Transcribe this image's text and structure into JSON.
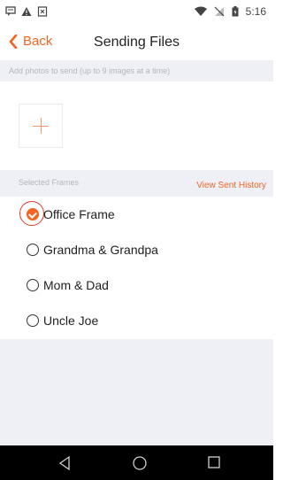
{
  "status_bar": {
    "time": "5:16",
    "left_icons": [
      "message-icon",
      "warning-icon",
      "download-box-icon"
    ],
    "right_icons": [
      "wifi-icon",
      "no-sim-icon",
      "battery-icon"
    ]
  },
  "nav": {
    "back_label": "Back",
    "title": "Sending Files"
  },
  "photos": {
    "hint": "Add photos to send (up to 9 images at a time)",
    "add_icon": "plus-icon"
  },
  "frames_section": {
    "label": "Selected Frames",
    "history_link": "View Sent History"
  },
  "frames": [
    {
      "name": "Office Frame",
      "selected": true
    },
    {
      "name": "Grandma & Grandpa",
      "selected": false
    },
    {
      "name": "Mom & Dad",
      "selected": false
    },
    {
      "name": "Uncle Joe",
      "selected": false
    }
  ],
  "android_nav": {
    "icons": [
      "back-triangle-icon",
      "home-circle-icon",
      "recents-square-icon"
    ]
  },
  "colors": {
    "accent": "#f26522",
    "section_bg": "#eef0f6"
  }
}
